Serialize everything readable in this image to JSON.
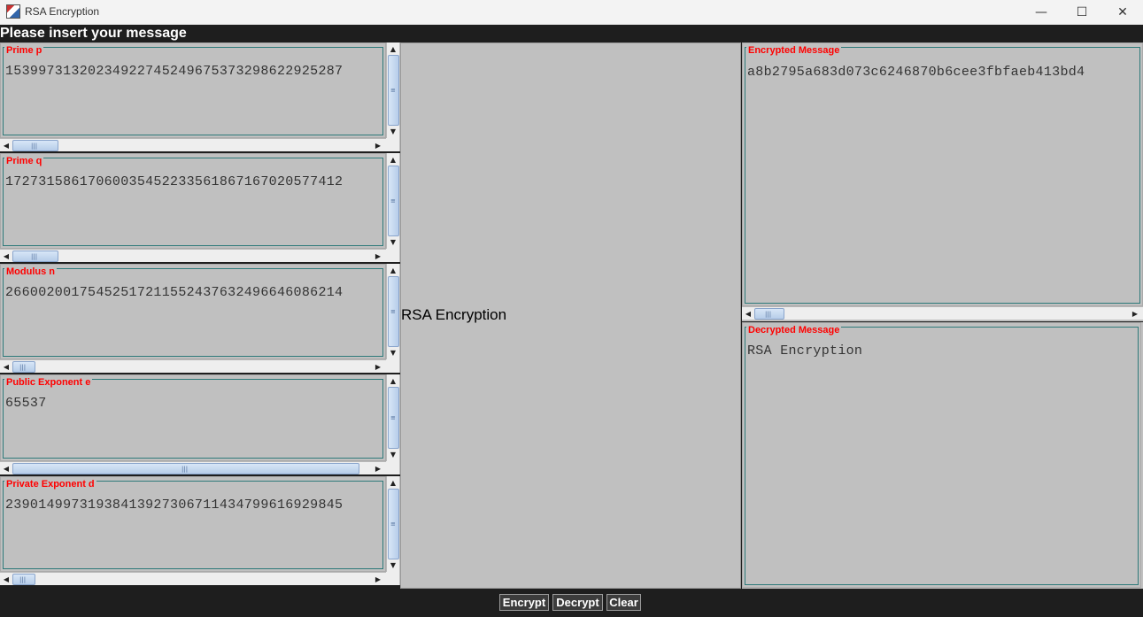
{
  "window": {
    "title": "RSA Encryption",
    "minimize_glyph": "—",
    "maximize_glyph": "☐",
    "close_glyph": "✕"
  },
  "header": {
    "text": "Please insert your message"
  },
  "fields": {
    "prime_p": {
      "label": "Prime p",
      "value": "15399731320234922745249675373298622925287"
    },
    "prime_q": {
      "label": "Prime q",
      "value": "17273158617060035452233561867167020577412"
    },
    "modulus_n": {
      "label": "Modulus n",
      "value": "26600200175452517211552437632496646086214"
    },
    "public_e": {
      "label": "Public Exponent e",
      "value": "65537"
    },
    "private_d": {
      "label": "Private Exponent d",
      "value": "23901499731938413927306711434799616929845"
    }
  },
  "center": {
    "message": "RSA Encryption"
  },
  "encrypted": {
    "label": "Encrypted Message",
    "value": "a8b2795a683d073c6246870b6cee3fbfaeb413bd4"
  },
  "decrypted": {
    "label": "Decrypted Message",
    "value": "RSA Encryption"
  },
  "buttons": {
    "encrypt": "Encrypt",
    "decrypt": "Decrypt",
    "clear": "Clear"
  },
  "icons": {
    "app": "java-cup-icon",
    "up": "▲",
    "down": "▼",
    "left": "◀",
    "right": "▶",
    "grip_v": "≡",
    "grip_h": "|||"
  }
}
